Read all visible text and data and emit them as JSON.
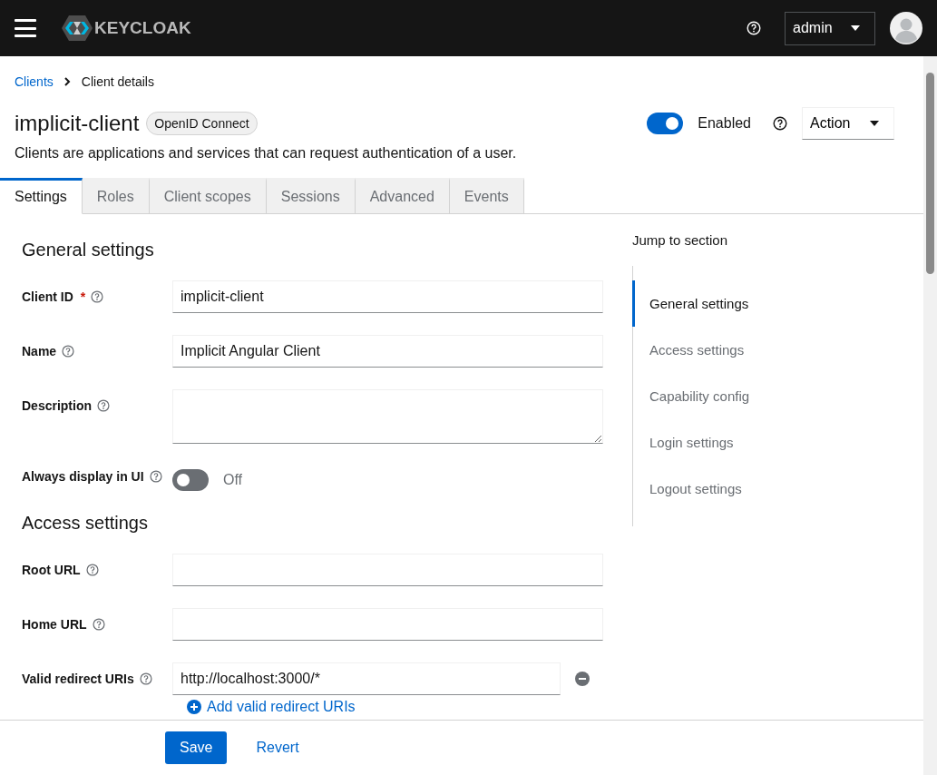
{
  "header": {
    "logo_text": "KEYCLOAK",
    "user": "admin"
  },
  "breadcrumb": [
    {
      "label": "Clients",
      "kind": "link"
    },
    {
      "label": "Client details",
      "kind": "current"
    }
  ],
  "client": {
    "name": "implicit-client",
    "badge": "OpenID Connect",
    "description": "Clients are applications and services that can request authentication of a user.",
    "enabled": {
      "on": true,
      "label": "Enabled"
    },
    "action": "Action"
  },
  "tabs": [
    {
      "label": "Settings",
      "selected": true
    },
    {
      "label": "Roles",
      "selected": false
    },
    {
      "label": "Client scopes",
      "selected": false
    },
    {
      "label": "Sessions",
      "selected": false
    },
    {
      "label": "Advanced",
      "selected": false
    },
    {
      "label": "Events",
      "selected": false
    }
  ],
  "sections": [
    {
      "title": "General settings",
      "fields": [
        {
          "kind": "input",
          "label": "Client ID",
          "required_mark": "*",
          "value": "implicit-client"
        },
        {
          "kind": "input",
          "label": "Name",
          "value": "Implicit Angular Client"
        },
        {
          "kind": "textarea",
          "label": "Description"
        },
        {
          "kind": "switch",
          "label": "Always display in UI",
          "on": false,
          "state_label": "Off"
        }
      ]
    },
    {
      "title": "Access settings",
      "fields": [
        {
          "kind": "input",
          "label": "Root URL"
        },
        {
          "kind": "input",
          "label": "Home URL"
        },
        {
          "kind": "multi",
          "label": "Valid redirect URIs",
          "values": [
            "http://localhost:3000/*"
          ],
          "add_label": "Add valid redirect URIs"
        }
      ]
    }
  ],
  "jump": {
    "title": "Jump to section",
    "items": [
      {
        "label": "General settings",
        "selected": true
      },
      {
        "label": "Access settings",
        "selected": false
      },
      {
        "label": "Capability config",
        "selected": false
      },
      {
        "label": "Login settings",
        "selected": false
      },
      {
        "label": "Logout settings",
        "selected": false
      }
    ]
  },
  "footer": {
    "save": "Save",
    "revert": "Revert"
  }
}
